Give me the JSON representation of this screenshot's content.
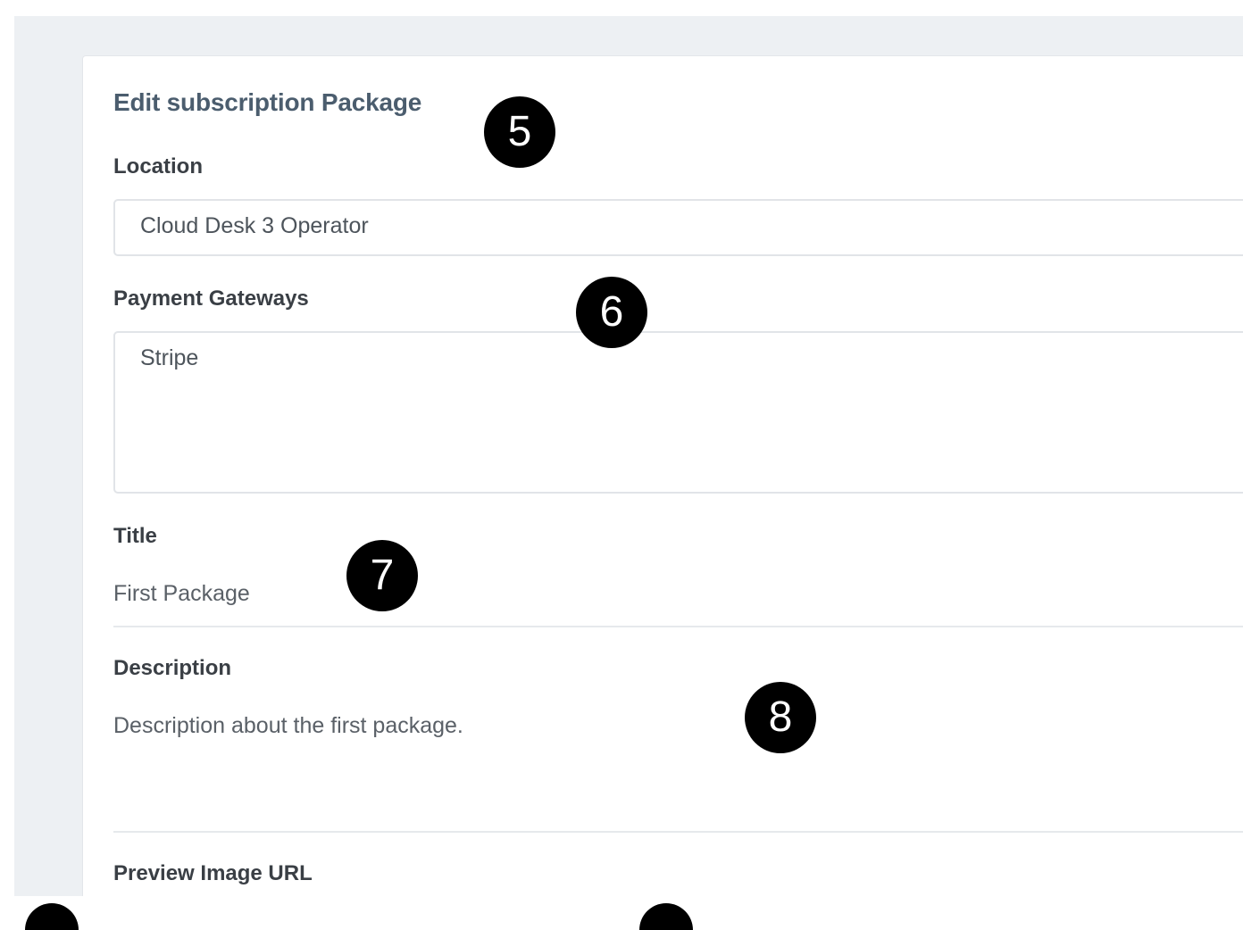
{
  "form": {
    "title": "Edit subscription Package",
    "location": {
      "label": "Location",
      "value": "Cloud Desk 3 Operator"
    },
    "payment_gateways": {
      "label": "Payment Gateways",
      "selected": [
        "Stripe"
      ]
    },
    "package_title": {
      "label": "Title",
      "value": "First Package"
    },
    "description": {
      "label": "Description",
      "value": "Description about the first package."
    },
    "preview_image_url": {
      "label": "Preview Image URL"
    }
  },
  "callouts": [
    "5",
    "6",
    "7",
    "8"
  ]
}
